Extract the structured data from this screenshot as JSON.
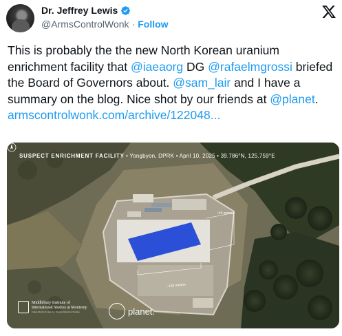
{
  "author": {
    "name": "Dr. Jeffrey Lewis",
    "handle": "@ArmsControlWonk",
    "separator": "·",
    "follow_label": "Follow"
  },
  "tweet": {
    "t1": "This is probably the the new North Korean uranium enrichment facility that ",
    "m1": "@iaeaorg",
    "t2": " DG ",
    "m2": "@rafaelmgrossi",
    "t3": " briefed the Board of Governors about.  ",
    "m3": "@sam_lair",
    "t4": " and I have a summary on the blog.  Nice shot by our friends at ",
    "m4": "@planet",
    "t5": ".",
    "link": "armscontrolwonk.com/archive/122048..."
  },
  "image": {
    "title_bold": "SUSPECT ENRICHMENT FACILITY",
    "title_rest": " • Yongbyon, DPRK  •  April 10, 2025  •  39.786°N, 125.759°E",
    "dim_width": "~120 meters",
    "dim_height": "~45 meters",
    "inst_line1": "Middlebury Institute of",
    "inst_line2": "International Studies at Monterey",
    "inst_line3": "James Martin Center for Nonproliferation Studies",
    "planet_label": "planet."
  },
  "icons": {
    "verified": "verified-badge-icon",
    "x": "x-logo-icon",
    "north": "north-arrow-icon"
  },
  "colors": {
    "link": "#1d9bf0",
    "handle": "#536471",
    "roof": "#2b4fd6"
  }
}
